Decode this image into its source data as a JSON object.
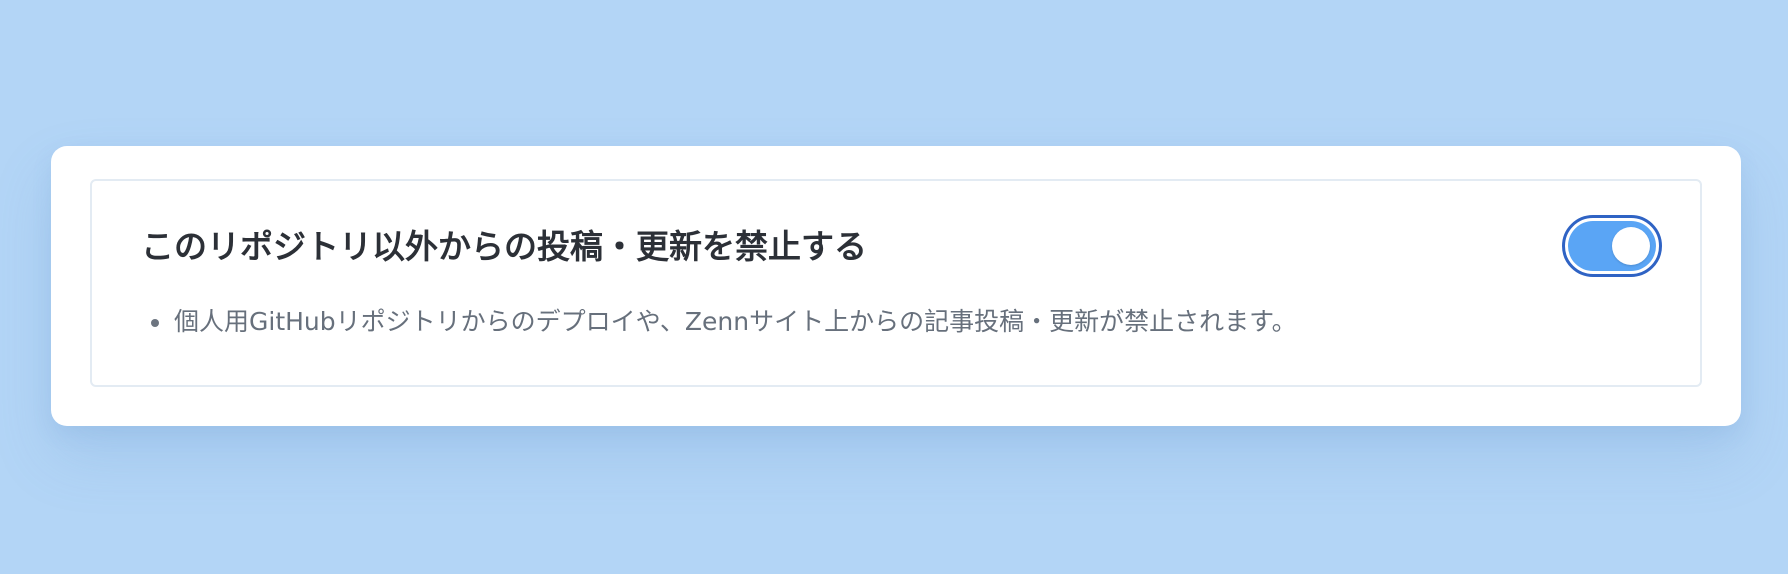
{
  "setting": {
    "title": "このリポジトリ以外からの投稿・更新を禁止する",
    "toggle_on": true,
    "descriptions": [
      "個人用GitHubリポジトリからのデプロイや、Zennサイト上からの記事投稿・更新が禁止されます。"
    ]
  },
  "colors": {
    "background": "#b3d5f6",
    "card": "#ffffff",
    "toggle_track": "#5aa5f5",
    "toggle_border": "#2f63c4",
    "title_text": "#2c3037",
    "description_text": "#67707c"
  }
}
